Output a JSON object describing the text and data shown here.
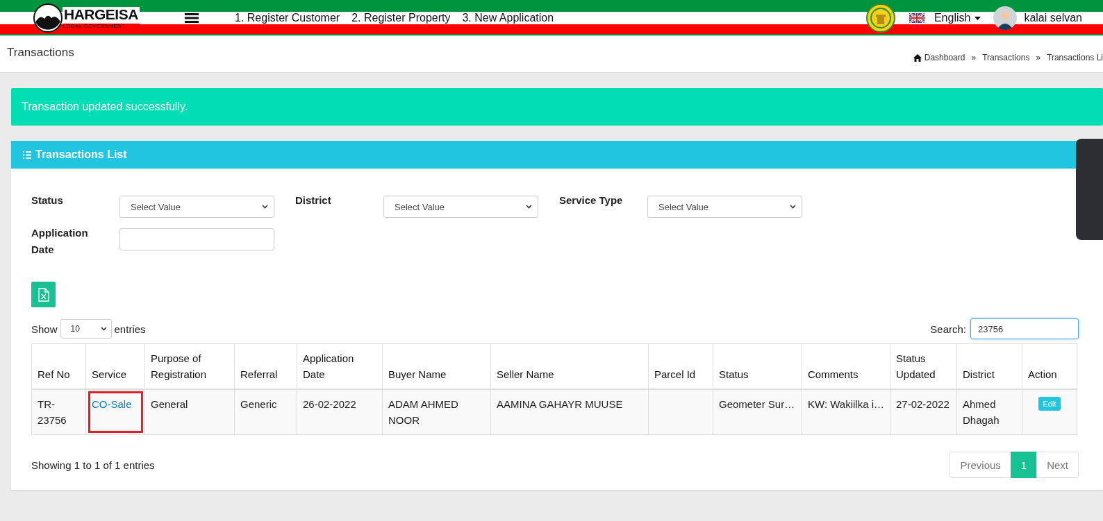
{
  "header": {
    "logo_title": "HARGEISA",
    "logo_subtitle": "LOCAL GOVERNMENT",
    "nav": [
      "1. Register Customer",
      "2. Register Property",
      "3. New Application"
    ],
    "language": "English",
    "user": "kalai selvan"
  },
  "page_title": "Transactions",
  "breadcrumb": {
    "separator": "»",
    "items": [
      "Dashboard",
      "Transactions",
      "Transactions Li"
    ]
  },
  "alert": {
    "message": "Transaction updated successfully."
  },
  "panel": {
    "title": "Transactions List",
    "filters": [
      {
        "kind": "select",
        "label": "Status",
        "value": "Select Value"
      },
      {
        "kind": "select",
        "label": "District",
        "value": "Select Value"
      },
      {
        "kind": "select",
        "label": "Service Type",
        "value": "Select Value"
      },
      {
        "kind": "date",
        "label": "Application Date"
      }
    ],
    "page_length": {
      "before": "Show",
      "value": "10",
      "after": "entries"
    },
    "search": {
      "label": "Search:",
      "value": "23756"
    },
    "table": {
      "columns": [
        {
          "label": "Ref No",
          "kind": "text"
        },
        {
          "label": "Service",
          "kind": "link"
        },
        {
          "label": "Purpose of Registration",
          "kind": "text"
        },
        {
          "label": "Referral",
          "kind": "text"
        },
        {
          "label": "Application Date",
          "kind": "text"
        },
        {
          "label": "Buyer Name",
          "kind": "text"
        },
        {
          "label": "Seller Name",
          "kind": "text"
        },
        {
          "label": "Parcel Id",
          "kind": "text"
        },
        {
          "label": "Status",
          "kind": "text"
        },
        {
          "label": "Comments",
          "kind": "text"
        },
        {
          "label": "Status Updated",
          "kind": "text"
        },
        {
          "label": "District",
          "kind": "text"
        },
        {
          "label": "Action",
          "kind": "button"
        }
      ],
      "rows": [
        {
          "cells": [
            {
              "text": "TR-23756",
              "highlighted": false
            },
            {
              "text": "CO-Sale",
              "highlighted": true
            },
            {
              "text": "General",
              "highlighted": false
            },
            {
              "text": "Generic",
              "highlighted": false
            },
            {
              "text": "26-02-2022",
              "highlighted": false
            },
            {
              "text": "ADAM AHMED NOOR",
              "highlighted": false
            },
            {
              "text": "AAMINA GAHAYR MUUSE",
              "highlighted": false
            },
            {
              "highlighted": false
            },
            {
              "text": "Geometer Sur…",
              "highlighted": false
            },
            {
              "text": "KW: Wakiilka i…",
              "highlighted": false
            },
            {
              "text": "27-02-2022",
              "highlighted": false
            },
            {
              "text": "Ahmed Dhagah",
              "highlighted": false
            },
            {
              "text": "Edit",
              "highlighted": false
            }
          ]
        }
      ]
    },
    "info": "Showing 1 to 1 of 1 entries",
    "pagination": [
      {
        "label": "Previous",
        "selected": false,
        "disabled": true
      },
      {
        "label": "1",
        "selected": true,
        "disabled": false
      },
      {
        "label": "Next",
        "selected": false,
        "disabled": true
      }
    ]
  }
}
